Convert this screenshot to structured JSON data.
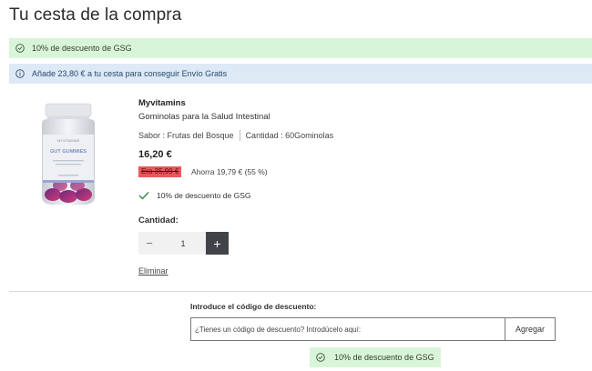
{
  "page": {
    "title": "Tu cesta de la compra"
  },
  "banners": {
    "discount": {
      "text": "10% de descuento de GSG",
      "icon": "check-circle-icon",
      "color": "#d9f5d9"
    },
    "shipping": {
      "text": "Añade 23,80 € a tu cesta para conseguir Envío Gratis",
      "icon": "info-icon",
      "color": "#dde9f5"
    }
  },
  "item": {
    "image_label_brand": "MYVITAMINS",
    "image_label_name": "GUT GUMMIES",
    "brand": "Myvitamins",
    "name": "Gominolas para la Salud Intestinal",
    "flavor": "Sabor : Frutas del Bosque",
    "size": "Cantidad : 60Gominolas",
    "price": "16,20 €",
    "old_price": "Era 35,99 €",
    "savings": "Ahorra 19,79 € (55 %)",
    "discount_label": "10% de descuento de GSG",
    "quantity_label": "Cantidad:",
    "quantity": "1",
    "minus": "−",
    "plus": "+",
    "remove": "Eliminar"
  },
  "promo": {
    "label": "Introduce el código de descuento:",
    "placeholder": "¿Tienes un código de descuento? Introdúcelo aquí:",
    "button": "Agregar",
    "applied": "10% de descuento de GSG"
  }
}
